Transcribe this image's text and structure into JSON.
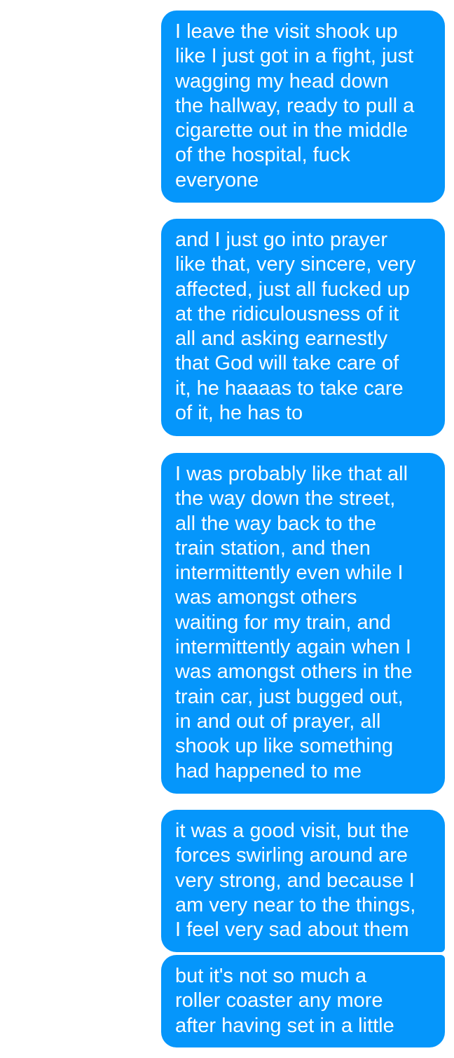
{
  "conversation": {
    "bubble_color": "#0596fb",
    "text_color": "#ffffff",
    "background_color": "#ffffff",
    "messages": [
      {
        "sender": "me",
        "text": "I leave the visit shook up\nlike I just got in a fight, just\nwagging my head down\nthe hallway, ready to pull a\ncigarette out in the middle\nof the hospital, fuck\neveryone"
      },
      {
        "sender": "me",
        "text": "and I just go into prayer\nlike that, very sincere, very\naffected, just all fucked up\nat the ridiculousness of it\nall and asking earnestly\nthat God will take care of\nit, he haaaas to take care\nof it, he has to"
      },
      {
        "sender": "me",
        "text": "I was probably like that all\nthe way down the street,\nall the way back to the\ntrain station, and then\nintermittently even while I\nwas amongst others\nwaiting for my train, and\nintermittently again when I\nwas amongst others in the\ntrain car, just bugged out,\nin and out of prayer, all\nshook up like something\nhad happened to me"
      },
      {
        "sender": "me",
        "text": "it was a good visit, but the\nforces swirling around are\nvery strong, and because I\nam very near to the things,\nI feel very sad about them"
      },
      {
        "sender": "me",
        "text": "but it's not so much a\nroller coaster any more\nafter having set in a little"
      }
    ]
  }
}
